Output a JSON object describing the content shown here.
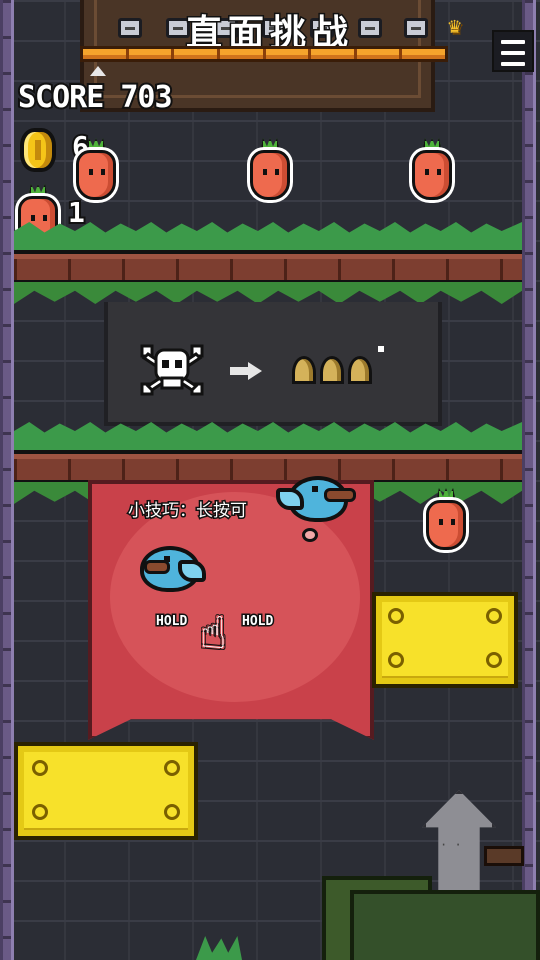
{
  "header": {
    "title": "直面挑战",
    "progress_segments": 8,
    "menu_icon": "menu-icon",
    "trophy_icon": "trophy-icon"
  },
  "hud": {
    "score_label": "SCORE 703",
    "coins": "6",
    "carrots": "1"
  },
  "tutorial": {
    "tip": "小技巧：长按可",
    "hold_left": "HOLD",
    "hold_right": "HOLD"
  },
  "colors": {
    "accent_orange": "#f5a42c",
    "banner_red": "#c9414a",
    "block_yellow": "#f7e12a",
    "bird_blue": "#4fb4dc",
    "grass_green": "#3c9a4a"
  }
}
